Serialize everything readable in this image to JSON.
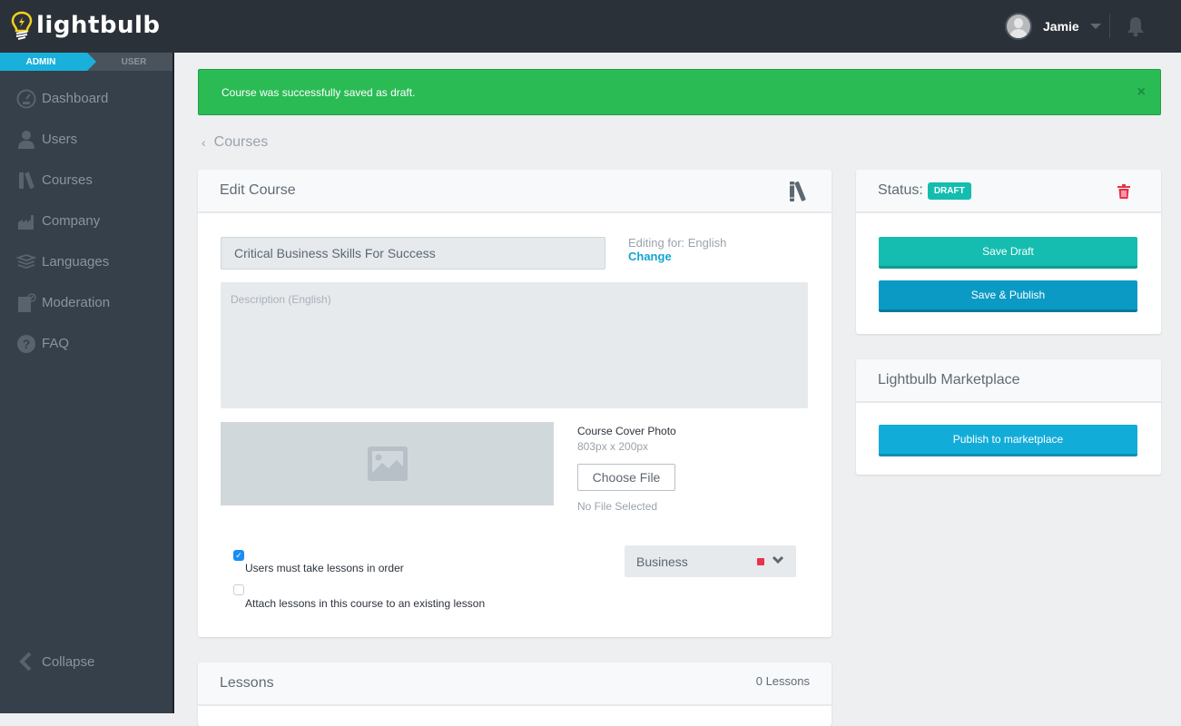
{
  "app": {
    "logo_text": "lightbulb",
    "brand_color": "#1ab0dc"
  },
  "header": {
    "user_name": "Jamie"
  },
  "sidebar": {
    "roles": [
      {
        "label": "ADMIN",
        "active": true
      },
      {
        "label": "USER",
        "active": false
      }
    ],
    "items": [
      {
        "label": "Dashboard",
        "icon": "dashboard-gauge-icon"
      },
      {
        "label": "Users",
        "icon": "user-icon"
      },
      {
        "label": "Courses",
        "icon": "books-icon"
      },
      {
        "label": "Company",
        "icon": "factory-icon"
      },
      {
        "label": "Languages",
        "icon": "layers-icon"
      },
      {
        "label": "Moderation",
        "icon": "moderation-icon"
      },
      {
        "label": "FAQ",
        "icon": "question-icon"
      }
    ],
    "collapse_label": "Collapse"
  },
  "alert": {
    "message": "Course was successfully saved as draft.",
    "close_symbol": "×",
    "color": "#2abb55"
  },
  "breadcrumb": {
    "back_symbol": "‹",
    "label": "Courses"
  },
  "edit_course": {
    "title": "Edit Course",
    "course_title_value": "Critical Business Skills For Success",
    "editing_for": "Editing for: English",
    "change_label": "Change",
    "description_placeholder": "Description (English)",
    "description_value": "",
    "cover_photo_label": "Course Cover Photo",
    "cover_photo_dims": "803px x 200px",
    "choose_file_label": "Choose File",
    "no_file_label": "No File Selected",
    "checkboxes": [
      {
        "label": "Users must take lessons in order",
        "checked": true,
        "check_mark": "✓"
      },
      {
        "label": "Attach lessons in this course to an existing lesson",
        "checked": false
      }
    ],
    "category": {
      "selected": "Business",
      "color": "#e8334a"
    }
  },
  "lessons": {
    "title": "Lessons",
    "count_label": "0 Lessons"
  },
  "status_panel": {
    "label": "Status:",
    "badge": "DRAFT",
    "save_draft_label": "Save Draft",
    "save_publish_label": "Save & Publish"
  },
  "marketplace": {
    "title": "Lightbulb Marketplace",
    "publish_label": "Publish to marketplace"
  }
}
